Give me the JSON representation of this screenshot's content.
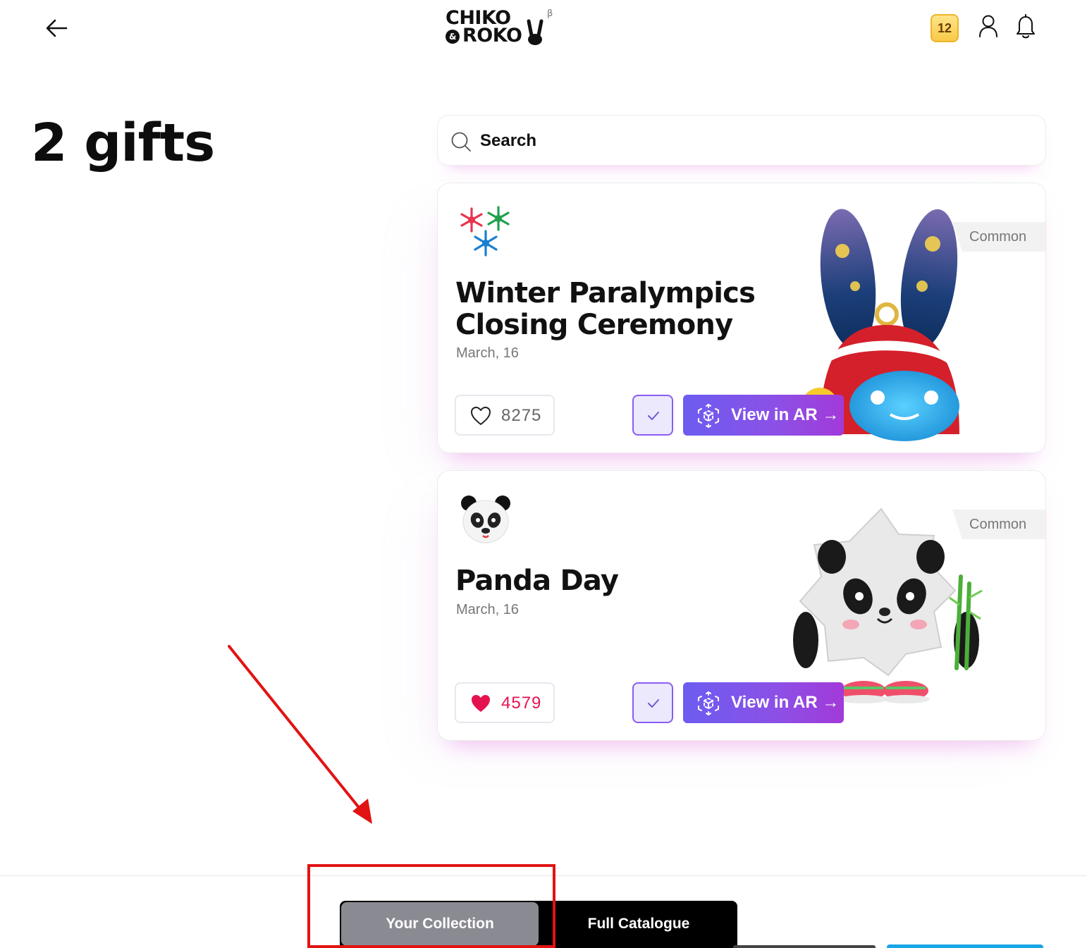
{
  "header": {
    "logo_line1": "CHIKO",
    "logo_line2": "ROKO",
    "logo_amp": "&",
    "logo_beta": "β",
    "coin_count": "12"
  },
  "page": {
    "title": "2 gifts"
  },
  "search": {
    "placeholder": "Search"
  },
  "cards": [
    {
      "title": "Winter Paralympics Closing Ceremony",
      "date": "March, 16",
      "rarity": "Common",
      "likes": "8275",
      "liked": false,
      "ar_label": "View in AR →",
      "emoji": "snowflakes-icon"
    },
    {
      "title": "Panda Day",
      "date": "March, 16",
      "rarity": "Common",
      "likes": "4579",
      "liked": true,
      "ar_label": "View in AR →",
      "emoji": "panda-face-icon"
    }
  ],
  "tabs": {
    "collection": "Your Collection",
    "catalogue": "Full Catalogue"
  },
  "colors": {
    "accent_gradient_start": "#6c5df0",
    "accent_gradient_end": "#a23ad8",
    "like_red": "#e4134f",
    "coin_yellow": "#f7c948",
    "annotation_red": "#e21313"
  }
}
